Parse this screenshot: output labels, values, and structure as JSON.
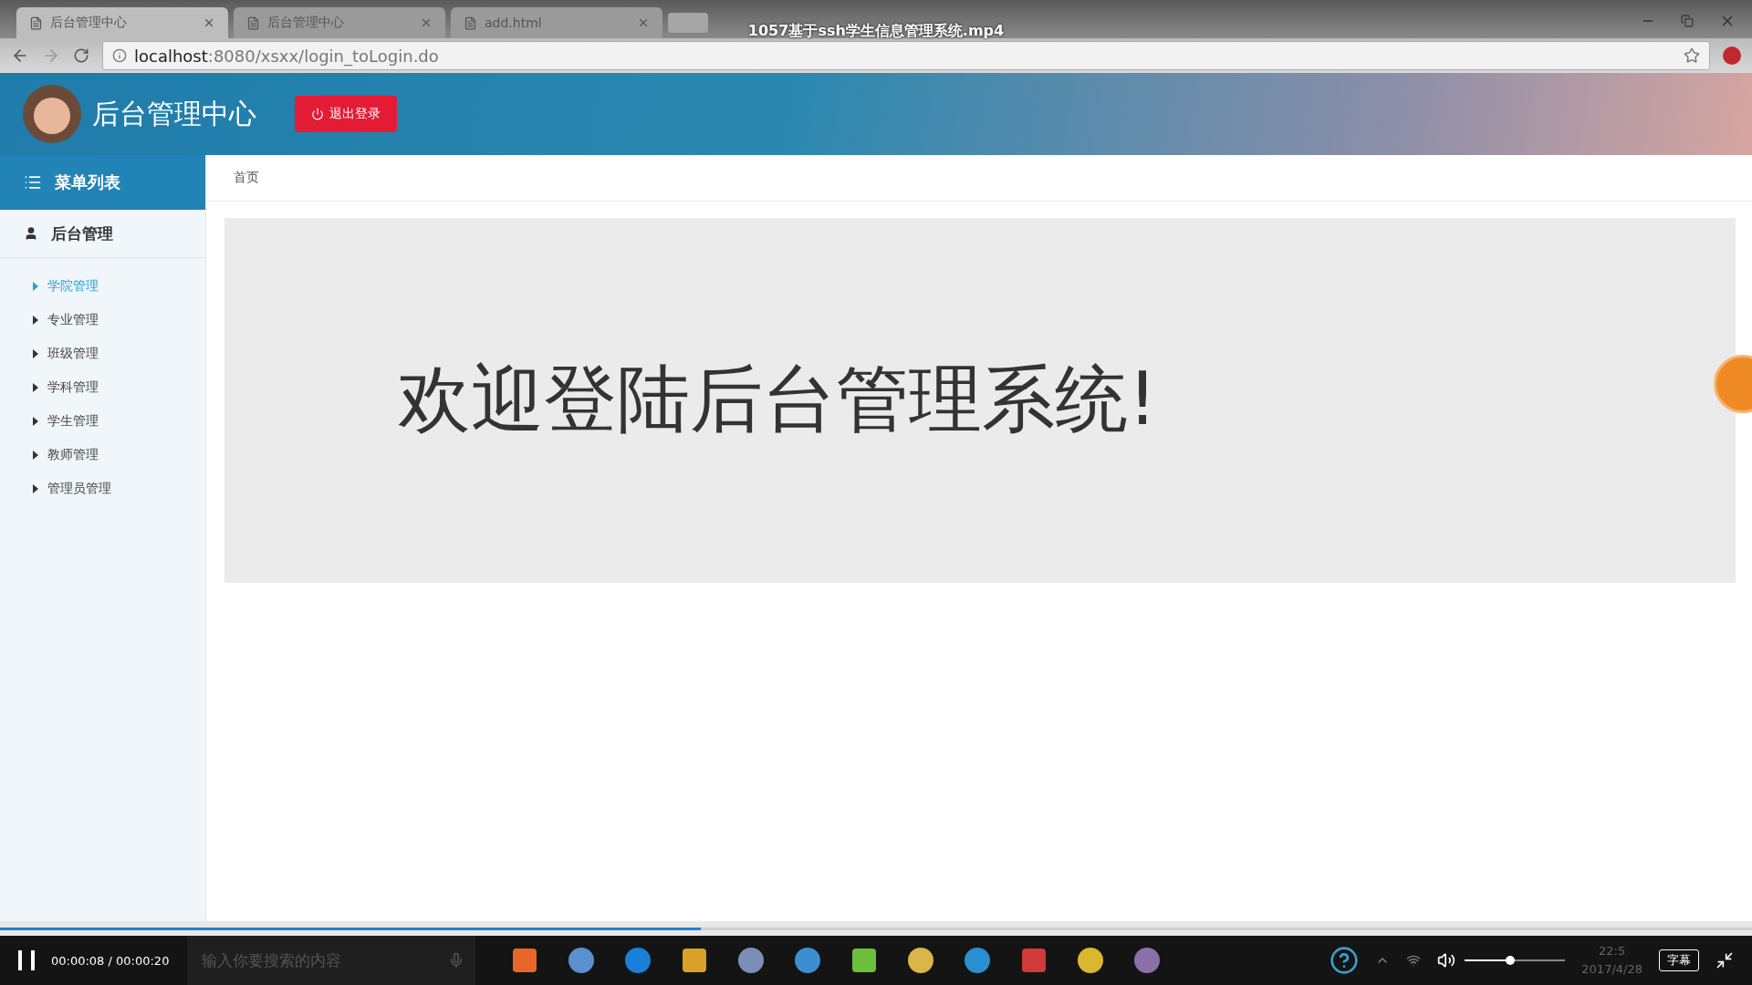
{
  "browser": {
    "tabs": [
      {
        "title": "后台管理中心",
        "selected": true
      },
      {
        "title": "后台管理中心",
        "selected": false
      },
      {
        "title": "add.html",
        "selected": false
      }
    ],
    "address": {
      "host": "localhost",
      "rest": ":8080/xsxx/login_toLogin.do"
    }
  },
  "video": {
    "title": "1057基于ssh学生信息管理系统.mp4",
    "progress": {
      "level": 0.4
    },
    "time": "00:00:08 / 00:00:20",
    "volume": {
      "level": 0.45
    },
    "subtitle_button": "字幕"
  },
  "page": {
    "header": {
      "title": "后台管理中心",
      "logout": "退出登录"
    },
    "sidebar": {
      "heading": "菜单列表",
      "group": "后台管理",
      "items": [
        {
          "label": "学院管理",
          "selected": true
        },
        {
          "label": "专业管理",
          "selected": false
        },
        {
          "label": "班级管理",
          "selected": false
        },
        {
          "label": "学科管理",
          "selected": false
        },
        {
          "label": "学生管理",
          "selected": false
        },
        {
          "label": "教师管理",
          "selected": false
        },
        {
          "label": "管理员管理",
          "selected": false
        }
      ]
    },
    "breadcrumb": "首页",
    "welcome": "欢迎登陆后台管理系统!"
  },
  "taskbar": {
    "search_placeholder": "输入你要搜索的内容",
    "clock": {
      "time": "22:5",
      "date": "2017/4/28"
    }
  }
}
